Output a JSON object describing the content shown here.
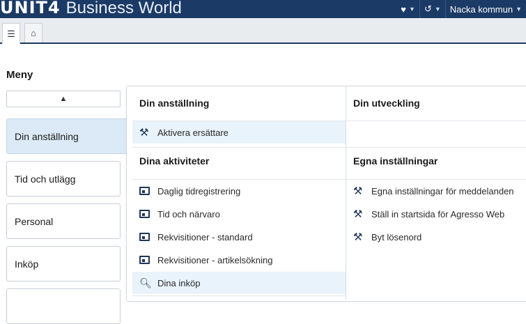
{
  "header": {
    "brand": "UNIT4",
    "product": "Business World",
    "user": "Nacka kommun"
  },
  "toolbar": {
    "tabs": [
      {
        "icon": "list-icon",
        "glyph": "☰"
      },
      {
        "icon": "home-icon",
        "glyph": "⌂"
      }
    ]
  },
  "sidebar": {
    "title": "Meny",
    "items": [
      {
        "label": "Din anställning",
        "active": true
      },
      {
        "label": "Tid och utlägg"
      },
      {
        "label": "Personal"
      },
      {
        "label": "Inköp"
      },
      {
        "label": ""
      }
    ]
  },
  "sections": {
    "din_anstallning": {
      "title": "Din anställning",
      "links": [
        {
          "label": "Aktivera ersättare",
          "icon": "tools-icon"
        }
      ]
    },
    "din_utveckling": {
      "title": "Din utveckling",
      "links": []
    },
    "dina_aktiviteter": {
      "title": "Dina aktiviteter",
      "links": [
        {
          "label": "Daglig tidregistrering",
          "icon": "screen-icon"
        },
        {
          "label": "Tid och närvaro",
          "icon": "screen-icon"
        },
        {
          "label": "Rekvisitioner - standard",
          "icon": "screen-icon"
        },
        {
          "label": "Rekvisitioner - artikelsökning",
          "icon": "screen-icon"
        },
        {
          "label": "Dina inköp",
          "icon": "search-icon"
        }
      ]
    },
    "egna_installningar": {
      "title": "Egna inställningar",
      "links": [
        {
          "label": "Egna inställningar för meddelanden",
          "icon": "tools-icon"
        },
        {
          "label": "Ställ in startsida för Agresso Web",
          "icon": "tools-icon"
        },
        {
          "label": "Byt lösenord",
          "icon": "tools-icon"
        }
      ]
    }
  },
  "colors": {
    "header_bg": "#1b3a66",
    "active_nav_bg": "#dbeaf6",
    "highlight_row_bg": "#e8f3fb"
  }
}
